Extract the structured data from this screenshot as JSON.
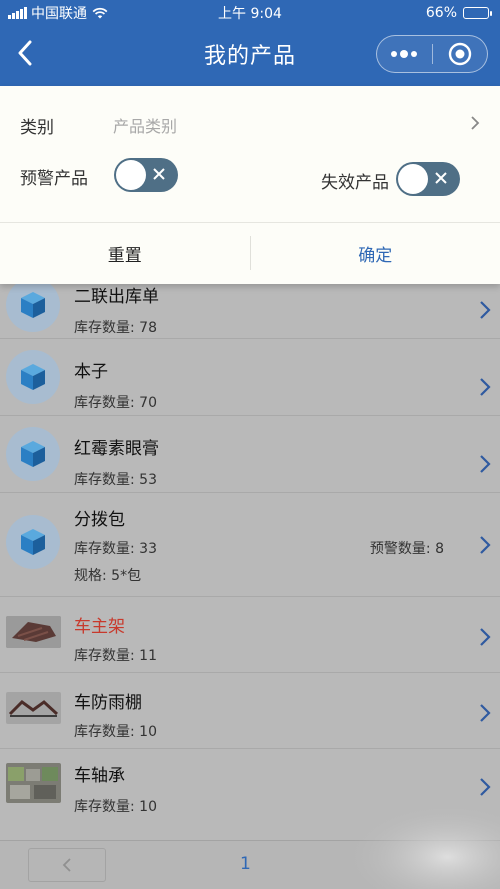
{
  "status_bar": {
    "carrier": "中国联通",
    "time": "上午 9:04",
    "battery": "66%",
    "battery_level": 0.66
  },
  "nav": {
    "title": "我的产品"
  },
  "filter": {
    "category_label": "类别",
    "category_placeholder": "产品类别",
    "warning_label": "预警产品",
    "invalid_label": "失效产品",
    "reset_label": "重置",
    "confirm_label": "确定",
    "accent_color": "#2f68b5"
  },
  "products": [
    {
      "name": "二联出库单",
      "stock": "库存数量: 78",
      "icon": "cube-icon"
    },
    {
      "name": "本子",
      "stock": "库存数量: 70",
      "icon": "cube-icon"
    },
    {
      "name": "红霉素眼膏",
      "stock": "库存数量: 53",
      "icon": "cube-icon"
    },
    {
      "name": "分拨包",
      "stock": "库存数量: 33",
      "warn_qty": "预警数量: 8",
      "spec": "规格: 5*包",
      "icon": "cube-icon"
    },
    {
      "name": "车主架",
      "stock": "库存数量: 11",
      "icon": "photo",
      "warning": true
    },
    {
      "name": "车防雨棚",
      "stock": "库存数量: 10",
      "icon": "photo"
    },
    {
      "name": "车轴承",
      "stock": "库存数量: 10",
      "icon": "photo"
    }
  ],
  "pager": {
    "page": "1"
  }
}
